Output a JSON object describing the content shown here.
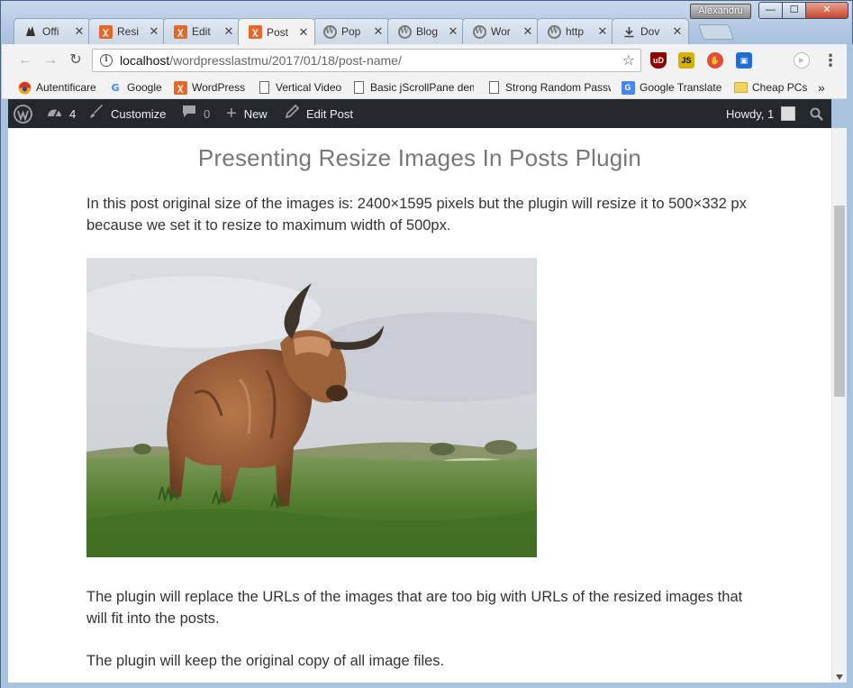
{
  "window": {
    "user_name": "Alexandru",
    "controls": {
      "minimize": "—",
      "maximize": "☐",
      "close": "✕"
    }
  },
  "tabs": [
    {
      "label": "Offi",
      "icon": "wolf-favicon",
      "active": false
    },
    {
      "label": "Resi",
      "icon": "xampp-favicon",
      "active": false
    },
    {
      "label": "Edit",
      "icon": "xampp-favicon",
      "active": false
    },
    {
      "label": "Post",
      "icon": "xampp-favicon",
      "active": true
    },
    {
      "label": "Pop",
      "icon": "wordpress-favicon",
      "active": false
    },
    {
      "label": "Blog",
      "icon": "wordpress-favicon",
      "active": false
    },
    {
      "label": "Wor",
      "icon": "wordpress-favicon",
      "active": false
    },
    {
      "label": "http",
      "icon": "wordpress-favicon",
      "active": false
    },
    {
      "label": "Dov",
      "icon": "download-favicon",
      "active": false
    }
  ],
  "toolbar": {
    "url_host": "localhost",
    "url_path": "/wordpresslastmu/2017/01/18/post-name/",
    "extensions": [
      {
        "name": "ublock-icon",
        "label": "uD",
        "color": "#8b0000"
      },
      {
        "name": "js-icon",
        "label": "JS",
        "color": "#d4b100"
      },
      {
        "name": "adblock-icon",
        "label": "✋",
        "color": "#e34c3c"
      },
      {
        "name": "screenshot-icon",
        "label": "▣",
        "color": "#1f6fd1"
      },
      {
        "name": "play-icon",
        "label": "▶",
        "color": "#bbbbbb"
      }
    ]
  },
  "bookmarks": [
    {
      "label": "Autentificare",
      "icon": "auth-icon"
    },
    {
      "label": "Google",
      "icon": "google-icon"
    },
    {
      "label": "WordPress",
      "icon": "xampp-icon"
    },
    {
      "label": "Vertical Video",
      "icon": "page-icon"
    },
    {
      "label": "Basic jScrollPane dem",
      "icon": "page-icon"
    },
    {
      "label": "Strong Random Passw",
      "icon": "page-icon"
    },
    {
      "label": "Google Translate",
      "icon": "google-translate-icon"
    },
    {
      "label": "Cheap PCs",
      "icon": "folder-icon"
    }
  ],
  "bookmarks_more": "»",
  "adminbar": {
    "updates_count": "4",
    "customize": "Customize",
    "comments_count": "0",
    "new": "New",
    "edit_post": "Edit Post",
    "howdy": "Howdy, 1"
  },
  "post": {
    "title": "Presenting Resize Images In Posts Plugin",
    "intro": "In this post original size of the images is: 2400×1595 pixels but the plugin will resize it to 500×332 px because we set it to resize to maximum width of 500px.",
    "para2": "The plugin will replace the URLs of the images that are too big with URLs of the resized images that will fit into the posts.",
    "para3": "The plugin will keep the original copy of all image files."
  }
}
